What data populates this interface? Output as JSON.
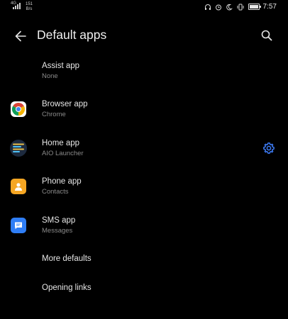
{
  "status_bar": {
    "network_type": "4G",
    "speed_value": "151",
    "speed_unit": "B/s",
    "time": "7:57"
  },
  "header": {
    "title": "Default apps",
    "back_icon": "arrow-left-icon",
    "search_icon": "search-icon"
  },
  "apps": [
    {
      "title": "Assist app",
      "value": "None",
      "icon": null
    },
    {
      "title": "Browser app",
      "value": "Chrome",
      "icon": "chrome-icon"
    },
    {
      "title": "Home app",
      "value": "AIO Launcher",
      "icon": "aio-launcher-icon",
      "settings_icon": "gear-icon"
    },
    {
      "title": "Phone app",
      "value": "Contacts",
      "icon": "contacts-icon"
    },
    {
      "title": "SMS app",
      "value": "Messages",
      "icon": "messages-icon"
    }
  ],
  "links": [
    {
      "title": "More defaults"
    },
    {
      "title": "Opening links"
    }
  ],
  "colors": {
    "background": "#000000",
    "accent": "#3d7bf5",
    "primary_text": "#e6e6e6",
    "secondary_text": "#8a8a8a"
  }
}
